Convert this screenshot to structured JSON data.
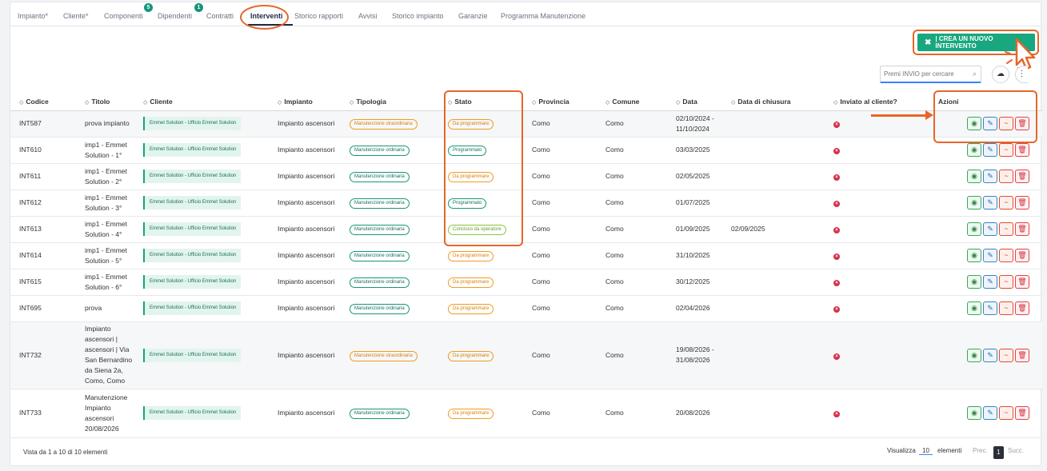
{
  "tabs": [
    {
      "label": "Impianto*"
    },
    {
      "label": "Cliente*"
    },
    {
      "label": "Componenti",
      "badge": "5"
    },
    {
      "label": "Dipendenti",
      "badge": "1"
    },
    {
      "label": "Contratti"
    },
    {
      "label": "Interventi"
    },
    {
      "label": "Storico rapporti"
    },
    {
      "label": "Avvisi"
    },
    {
      "label": "Storico impianto"
    },
    {
      "label": "Garanzie"
    },
    {
      "label": "Programma Manutenzione"
    }
  ],
  "toolbar": {
    "create_label": "|  CREA UN NUOVO INTERVENTO",
    "search_placeholder": "Premi INVIO per cercare"
  },
  "columns": [
    "Codice",
    "Titolo",
    "Cliente",
    "Impianto",
    "Tipologia",
    "Stato",
    "Provincia",
    "Comune",
    "Data",
    "Data di chiusura",
    "Inviato al cliente?",
    "Azioni"
  ],
  "rows": [
    {
      "codice": "INT587",
      "titolo": "prova impianto",
      "cliente": "Emmet Solution - Ufficio Emmet Solution",
      "impianto": "Impianto ascensori",
      "tipologia": "Manutenzione straordinaria",
      "stato": "Da programmare",
      "provincia": "Como",
      "comune": "Como",
      "data": "02/10/2024 - 11/10/2024",
      "chiusura": ""
    },
    {
      "codice": "INT610",
      "titolo": "imp1 - Emmet Solution - 1°",
      "cliente": "Emmet Solution - Ufficio Emmet Solution",
      "impianto": "Impianto ascensori",
      "tipologia": "Manutenzione ordinaria",
      "stato": "Programmato",
      "provincia": "Como",
      "comune": "Como",
      "data": "03/03/2025",
      "chiusura": ""
    },
    {
      "codice": "INT611",
      "titolo": "imp1 - Emmet Solution - 2°",
      "cliente": "Emmet Solution - Ufficio Emmet Solution",
      "impianto": "Impianto ascensori",
      "tipologia": "Manutenzione ordinaria",
      "stato": "Da programmare",
      "provincia": "Como",
      "comune": "Como",
      "data": "02/05/2025",
      "chiusura": ""
    },
    {
      "codice": "INT612",
      "titolo": "imp1 - Emmet Solution - 3°",
      "cliente": "Emmet Solution - Ufficio Emmet Solution",
      "impianto": "Impianto ascensori",
      "tipologia": "Manutenzione ordinaria",
      "stato": "Programmato",
      "provincia": "Como",
      "comune": "Como",
      "data": "01/07/2025",
      "chiusura": ""
    },
    {
      "codice": "INT613",
      "titolo": "imp1 - Emmet Solution - 4°",
      "cliente": "Emmet Solution - Ufficio Emmet Solution",
      "impianto": "Impianto ascensori",
      "tipologia": "Manutenzione ordinaria",
      "stato": "Concluso da operatore",
      "provincia": "Como",
      "comune": "Como",
      "data": "01/09/2025",
      "chiusura": "02/09/2025"
    },
    {
      "codice": "INT614",
      "titolo": "imp1 - Emmet Solution - 5°",
      "cliente": "Emmet Solution - Ufficio Emmet Solution",
      "impianto": "Impianto ascensori",
      "tipologia": "Manutenzione ordinaria",
      "stato": "Da programmare",
      "provincia": "Como",
      "comune": "Como",
      "data": "31/10/2025",
      "chiusura": ""
    },
    {
      "codice": "INT615",
      "titolo": "imp1 - Emmet Solution - 6°",
      "cliente": "Emmet Solution - Ufficio Emmet Solution",
      "impianto": "Impianto ascensori",
      "tipologia": "Manutenzione ordinaria",
      "stato": "Da programmare",
      "provincia": "Como",
      "comune": "Como",
      "data": "30/12/2025",
      "chiusura": ""
    },
    {
      "codice": "INT695",
      "titolo": "prova",
      "cliente": "Emmet Solution - Ufficio Emmet Solution",
      "impianto": "Impianto ascensori",
      "tipologia": "Manutenzione ordinaria",
      "stato": "Da programmare",
      "provincia": "Como",
      "comune": "Como",
      "data": "02/04/2026",
      "chiusura": ""
    },
    {
      "codice": "INT732",
      "titolo": "Impianto ascensori | ascensori | Via San Bernardino da Siena 2a, Como, Como",
      "cliente": "Emmet Solution - Ufficio Emmet Solution",
      "impianto": "Impianto ascensori",
      "tipologia": "Manutenzione straordinaria",
      "stato": "Da programmare",
      "provincia": "Como",
      "comune": "Como",
      "data": "19/08/2026 - 31/08/2026",
      "chiusura": ""
    },
    {
      "codice": "INT733",
      "titolo": "Manutenzione Impianto ascensori 20/08/2026",
      "cliente": "Emmet Solution - Ufficio Emmet Solution",
      "impianto": "Impianto ascensori",
      "tipologia": "Manutenzione ordinaria",
      "stato": "Da programmare",
      "provincia": "Como",
      "comune": "Como",
      "data": "20/08/2026",
      "chiusura": ""
    }
  ],
  "footer": {
    "info": "Vista da 1 a 10 di 10 elementi",
    "show_label": "Visualizza",
    "page_size": "10",
    "elements_label": "elementi",
    "prev": "Prec.",
    "page": "1",
    "next": "Succ."
  },
  "colors": {
    "accent": "#18a77f",
    "annotation": "#e5662a"
  }
}
